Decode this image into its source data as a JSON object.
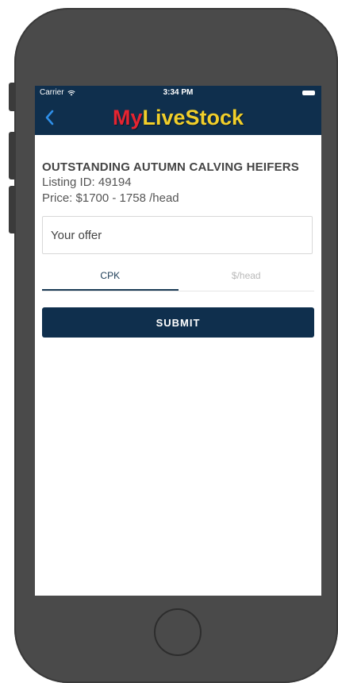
{
  "status_bar": {
    "carrier": "Carrier",
    "time": "3:34 PM"
  },
  "nav": {
    "title_part1": "My",
    "title_part2": "LiveStock"
  },
  "listing": {
    "title": "OUTSTANDING AUTUMN CALVING HEIFERS",
    "listing_id": "Listing ID: 49194",
    "price": "Price: $1700 - 1758 /head"
  },
  "offer": {
    "placeholder": "Your offer"
  },
  "tabs": [
    {
      "label": "CPK",
      "active": true
    },
    {
      "label": "$/head",
      "active": false
    }
  ],
  "submit_label": "SUBMIT",
  "colors": {
    "navy": "#0f2f4d",
    "title_red": "#e52431",
    "title_yellow": "#f1cf2a",
    "back_arrow": "#2f8fe8"
  },
  "icons": [
    "wifi-icon",
    "battery-icon",
    "back-chevron-icon"
  ]
}
